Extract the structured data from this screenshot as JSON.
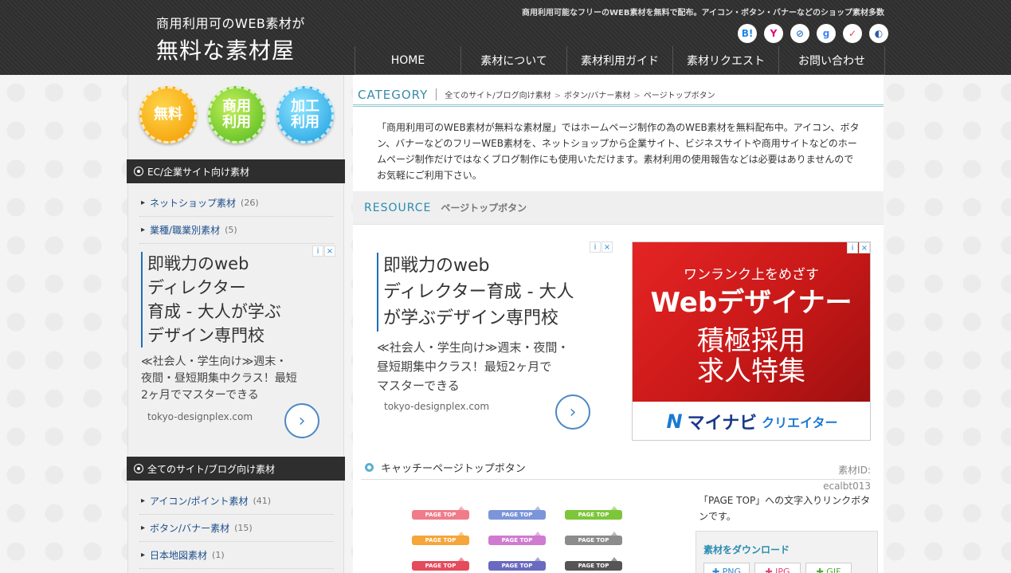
{
  "header": {
    "logo_sub": "商用利用可のWEB素材が",
    "logo_main": "無料な素材屋",
    "tagline": "商用利用可能なフリーのWEB素材を無料で配布。アイコン・ボタン・バナーなどのショップ素材多数",
    "social": [
      "B!",
      "Y",
      "⊘",
      "g",
      "✓",
      "◐"
    ],
    "nav": [
      "HOME",
      "素材について",
      "素材利用ガイド",
      "素材リクエスト",
      "お問い合わせ"
    ]
  },
  "sidebar": {
    "badges": [
      {
        "line1": "無料",
        "line2": ""
      },
      {
        "line1": "商用",
        "line2": "利用"
      },
      {
        "line1": "加工",
        "line2": "利用"
      }
    ],
    "section1_title": "EC/企業サイト向け素材",
    "section1_items": [
      {
        "label": "ネットショップ素材",
        "count": "(26)"
      },
      {
        "label": "業種/職業別素材",
        "count": "(5)"
      }
    ],
    "ad": {
      "title_l1": "即戦力のweb",
      "title_l2": "ディレクター",
      "title_l3": "育成 - 大人が学ぶ",
      "title_l4": "デザイン専門校",
      "desc_l1": "≪社会人・学生向け≫週末・",
      "desc_l2": "夜間・昼短期集中クラス！最短",
      "desc_l3": "2ヶ月でマスターできる",
      "url": "tokyo-designplex.com",
      "adchoice_i": "i",
      "adchoice_x": "×",
      "arrow": "›"
    },
    "section2_title": "全てのサイト/ブログ向け素材",
    "section2_items": [
      {
        "label": "アイコン/ポイント素材",
        "count": "(41)"
      },
      {
        "label": "ボタン/バナー素材",
        "count": "(15)"
      },
      {
        "label": "日本地図素材",
        "count": "(1)"
      }
    ]
  },
  "main": {
    "category_label": "CATEGORY",
    "breadcrumb": [
      "全てのサイト/ブログ向け素材",
      "ボタン/バナー素材",
      "ページトップボタン"
    ],
    "breadcrumb_sep": ">",
    "intro": "「商用利用可のWEB素材が無料な素材屋」ではホームページ制作の為のWEB素材を無料配布中。アイコン、ボタン、バナーなどのフリーWEB素材を、ネットショップから企業サイト、ビジネスサイトや商用サイトなどのホームページ制作だけではなくブログ制作にも使用いただけます。素材利用の使用報告などは必要はありませんのでお気軽にご利用下さい。",
    "resource_label": "RESOURCE",
    "resource_sub": "ページトップボタン",
    "ad": {
      "title_l1": "即戦力のweb",
      "title_l2": "ディレクター育成 - 大人",
      "title_l3": "が学ぶデザイン専門校",
      "desc_l1": "≪社会人・学生向け≫週末・夜間・",
      "desc_l2": "昼短期集中クラス！最短2ヶ月で",
      "desc_l3": "マスターできる",
      "url": "tokyo-designplex.com",
      "adchoice_i": "i",
      "adchoice_x": "×",
      "arrow": "›"
    },
    "image_ad": {
      "line1": "ワンランク上をめざす",
      "line2": "Webデザイナー",
      "line3": "積極採用",
      "line4": "求人特集",
      "brand_mark": "N",
      "brand_1": "マイナビ",
      "brand_2": "クリエイター",
      "adchoice_i": "i",
      "adchoice_x": "×"
    },
    "item": {
      "title": "キャッチーページトップボタン",
      "id_label": "素材ID:",
      "id_value": "ecalbt013",
      "description": "「PAGE TOP」への文字入りリンクボタンです。",
      "button_text": "PAGE TOP",
      "button_colors": [
        "#f07c8a",
        "#7b95d9",
        "#7cc63a",
        "#f5a53a",
        "#d07ad0",
        "#8c8c8c",
        "#e54b5b",
        "#6a6ac0",
        "#555555"
      ]
    },
    "download": {
      "title": "素材をダウンロード",
      "buttons": [
        "✚ PNG",
        "✚ JPG",
        "✚ GIF"
      ]
    }
  },
  "colors": {
    "header_bg": "#2e2e2e",
    "accent": "#3a8ca8",
    "link": "#1d4e8a"
  }
}
